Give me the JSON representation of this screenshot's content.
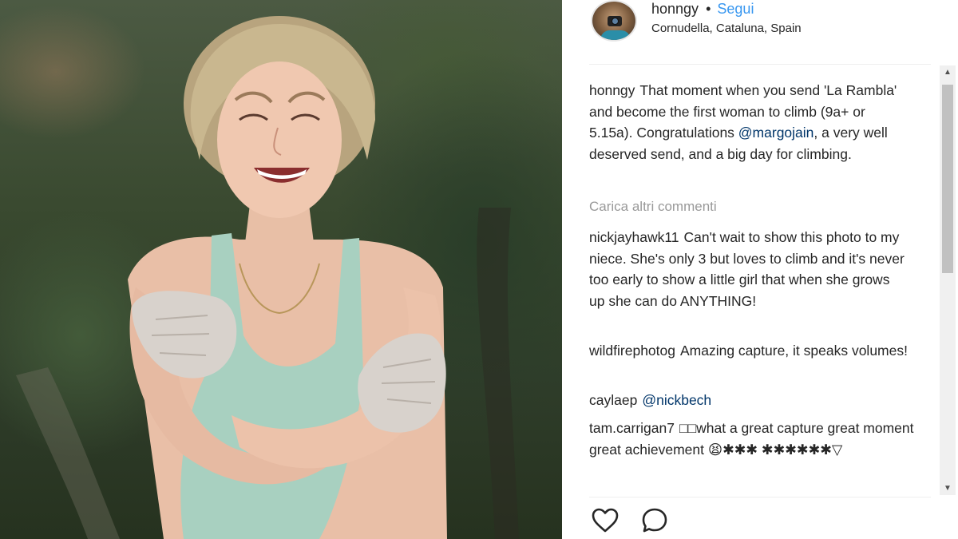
{
  "post": {
    "username": "honngy",
    "separator": "•",
    "follow_label": "Segui",
    "location": "Cornudella, Cataluna, Spain"
  },
  "caption": {
    "username": "honngy",
    "text_before": "That moment when you send 'La Rambla' and become the first woman to climb (9a+ or 5.15a). Congratulations ",
    "mention": "@margojain",
    "text_after": ", a very well deserved send, and a big day for climbing."
  },
  "load_more_label": "Carica altri commenti",
  "comments": [
    {
      "username": "nickjayhawk11",
      "text": "Can't wait to show this photo to my niece. She's only 3 but loves to climb and it's never too early to show a little girl that when she grows up she can do ANYTHING!"
    },
    {
      "username": "wildfirephotog",
      "text": "Amazing capture, it speaks volumes!"
    },
    {
      "username": "caylaep",
      "text": "@nickbech"
    },
    {
      "username": "tam.carrigan7",
      "text": "□□what a great capture great moment great achievement 😫✱✱✱ ✱✱✱✱✱✱▽"
    },
    {
      "username": "",
      "text": ""
    }
  ],
  "icons": {
    "like": "heart-icon",
    "comment": "comment-bubble-icon",
    "scroll_up": "scroll-up-arrow-icon",
    "scroll_down": "scroll-down-arrow-icon"
  },
  "colors": {
    "link_blue": "#3897f0",
    "mention_blue": "#003569",
    "muted_gray": "#999999",
    "text": "#262626"
  }
}
